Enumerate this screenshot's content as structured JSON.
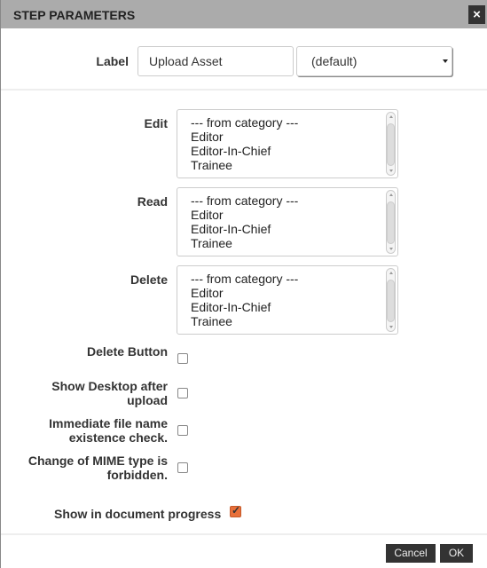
{
  "dialog": {
    "title": "STEP PARAMETERS",
    "close_icon": "×"
  },
  "label_field": {
    "label": "Label",
    "value": "Upload Asset",
    "select_value": "(default)"
  },
  "permissions": [
    {
      "label": "Edit",
      "options": [
        "--- from category ---",
        "Editor",
        "Editor-In-Chief",
        "Trainee"
      ]
    },
    {
      "label": "Read",
      "options": [
        "--- from category ---",
        "Editor",
        "Editor-In-Chief",
        "Trainee"
      ]
    },
    {
      "label": "Delete",
      "options": [
        "--- from category ---",
        "Editor",
        "Editor-In-Chief",
        "Trainee"
      ]
    }
  ],
  "checkboxes": [
    {
      "label_line1": "Delete Button",
      "label_line2": "",
      "checked": false
    },
    {
      "label_line1": "Show Desktop after",
      "label_line2": "upload",
      "checked": false
    },
    {
      "label_line1": "Immediate file name",
      "label_line2": "existence check.",
      "checked": false
    },
    {
      "label_line1": "Change of MIME type is",
      "label_line2": "forbidden.",
      "checked": false
    }
  ],
  "progress_option": {
    "label": "Show in document progress",
    "checked": true,
    "checkmark": "✓",
    "accent_color": "#e8703a"
  },
  "footer": {
    "cancel_label": "Cancel",
    "ok_label": "OK"
  }
}
